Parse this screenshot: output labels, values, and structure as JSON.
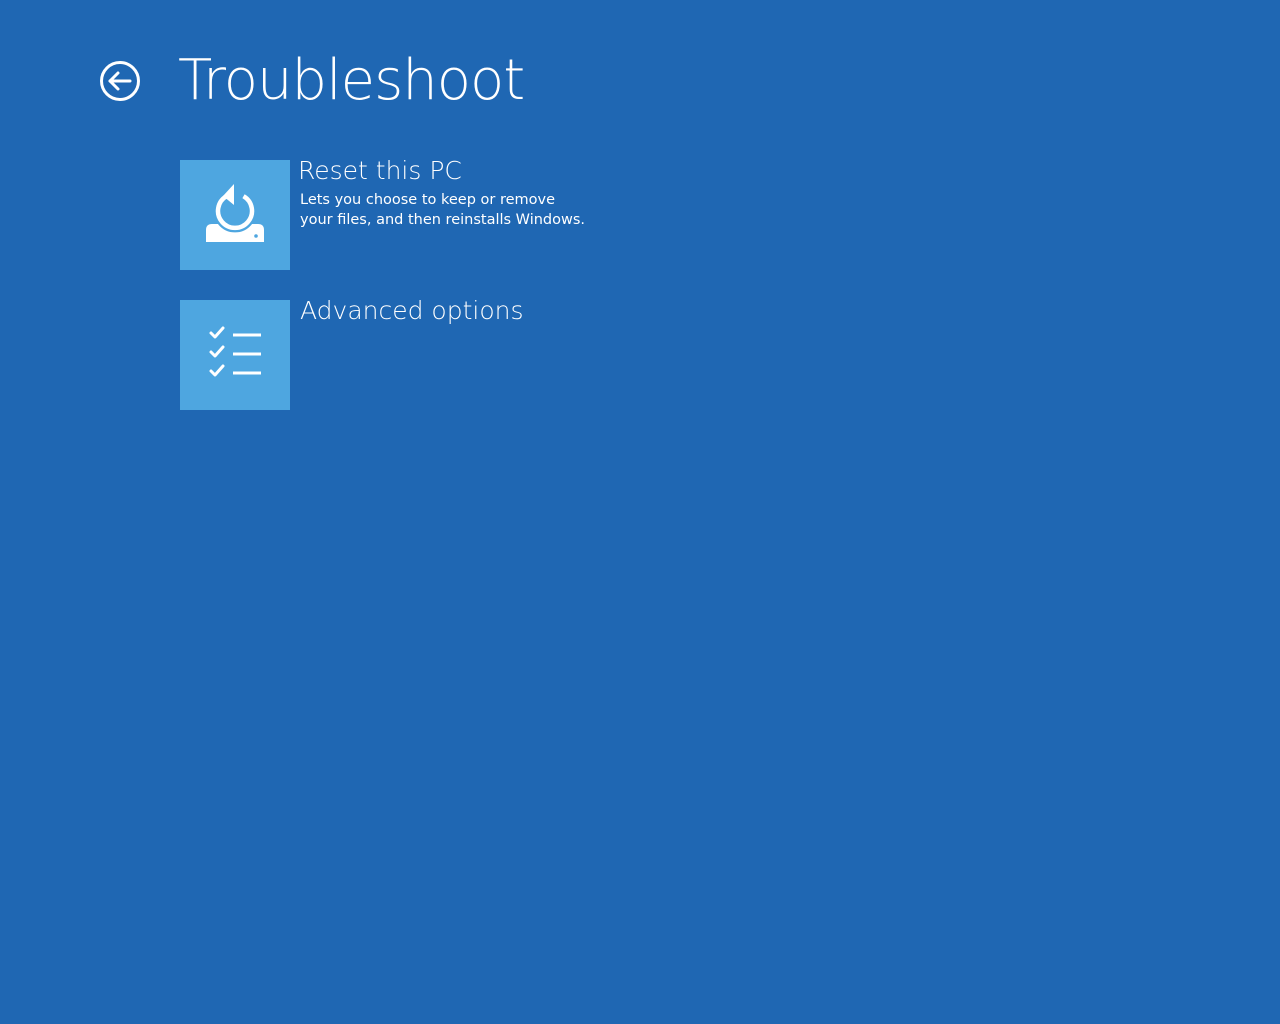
{
  "header": {
    "back_icon": "back-arrow-circle-icon",
    "title": "Troubleshoot"
  },
  "options": [
    {
      "icon": "reset-pc-icon",
      "title": "Reset this PC",
      "description": "Lets you choose to keep or remove\nyour files, and then reinstalls Windows."
    },
    {
      "icon": "checklist-icon",
      "title": "Advanced options"
    }
  ],
  "colors": {
    "background": "#1f67b3",
    "tile": "#4ea6e0",
    "text": "#ffffff"
  }
}
